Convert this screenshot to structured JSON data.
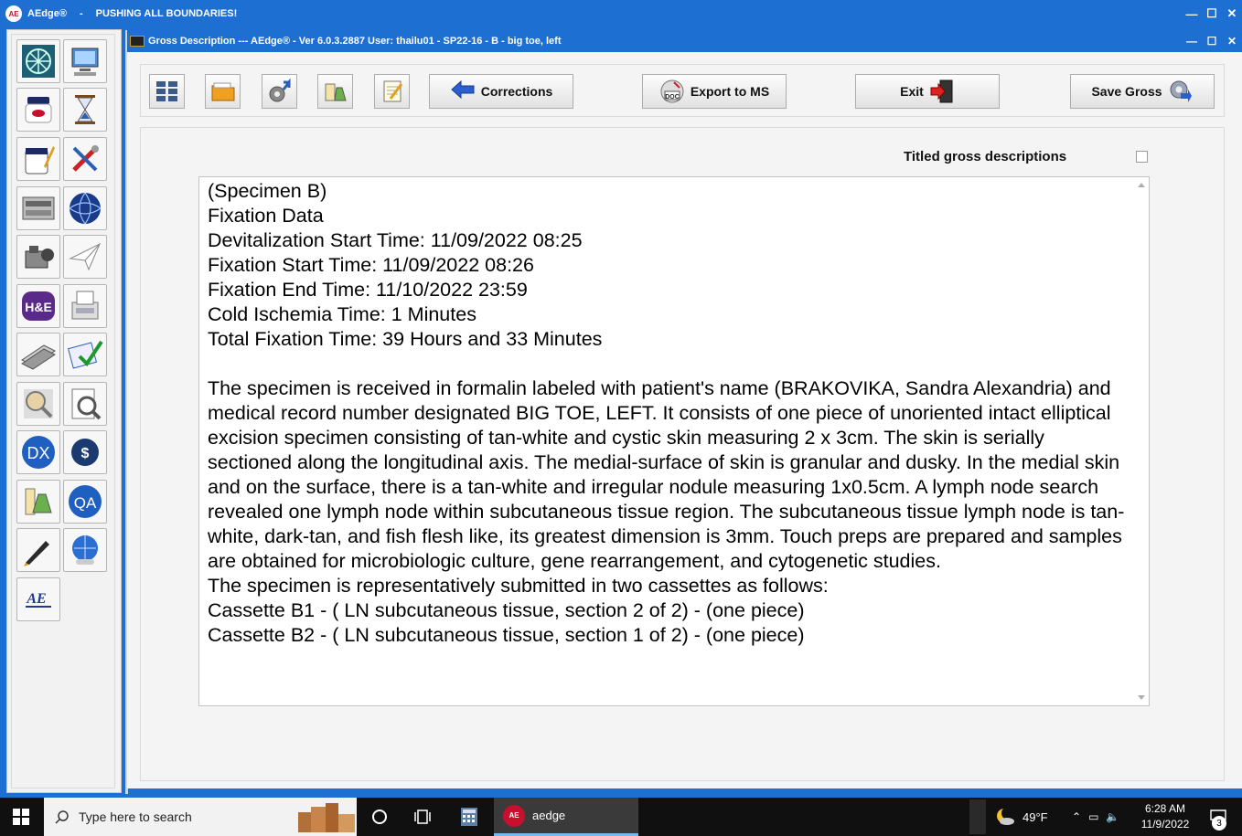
{
  "app": {
    "title": "AEdge®",
    "separator": "-",
    "slogan": "PUSHING ALL BOUNDARIES!",
    "logo_text": "AE"
  },
  "window_controls": {
    "minimize": "—",
    "maximize": "☐",
    "close": "✕"
  },
  "child_window": {
    "title": "Gross Description --- AEdge® -  Ver 6.0.3.2887  User: thailu01 - SP22-16 - B - big toe, left"
  },
  "left_toolbar": {
    "icons": [
      "network-icon",
      "computer-icon",
      "specimen-jar-icon",
      "hourglass-icon",
      "paint-jar-icon",
      "tools-icon",
      "printer-machine-icon",
      "globe-icon",
      "microtome-icon",
      "paper-plane-icon",
      "h-and-e-stain-icon",
      "fax-icon",
      "slides-stack-icon",
      "e-checkmark-icon",
      "magnifier-icon",
      "document-search-icon",
      "dx-icon",
      "billing-icon",
      "lab-flasks-icon",
      "qa-icon",
      "fountain-pen-icon",
      "web-help-icon",
      "aedge-logo-icon"
    ],
    "dx_label": "DX",
    "qa_label": "QA",
    "he_label": "H&E",
    "billing_label": "$",
    "aedge_label": "AE"
  },
  "toolbar": {
    "corrections_label": "Corrections",
    "export_label": "Export to MS",
    "exit_label": "Exit",
    "save_label": "Save Gross",
    "doc_badge": "DOC"
  },
  "gross": {
    "titled_label": "Titled gross descriptions",
    "titled_checked": false,
    "text": "(Specimen B)\nFixation Data\nDevitalization Start Time: 11/09/2022 08:25\nFixation Start Time: 11/09/2022 08:26\nFixation End Time: 11/10/2022 23:59\nCold Ischemia Time: 1 Minutes\nTotal Fixation Time: 39 Hours and 33 Minutes\n\nThe specimen is received in formalin labeled with patient's name (BRAKOVIKA, Sandra Alexandria) and medical record number designated BIG TOE, LEFT. It consists of one piece of unoriented intact elliptical excision specimen consisting of tan-white and cystic skin measuring 2 x 3cm. The skin is serially sectioned along the longitudinal axis. The medial-surface of skin is granular and dusky. In the medial skin and on the surface, there is a tan-white and irregular nodule measuring 1x0.5cm. A lymph node search revealed one lymph node within subcutaneous tissue region. The subcutaneous tissue lymph node is tan-white, dark-tan, and fish flesh like, its greatest dimension is 3mm. Touch preps are prepared and samples are obtained for microbiologic culture, gene rearrangement, and cytogenetic studies.\nThe specimen is representatively submitted in two cassettes as follows:\nCassette B1 - ( LN subcutaneous tissue, section 2 of 2) - (one piece)\nCassette B2 - ( LN subcutaneous tissue, section 1 of 2) - (one piece)"
  },
  "taskbar": {
    "search_placeholder": "Type here to search",
    "app_label": "aedge",
    "app_logo_text": "AE",
    "weather_temp": "49°F",
    "time": "6:28 AM",
    "date": "11/9/2022",
    "notification_count": "3"
  }
}
